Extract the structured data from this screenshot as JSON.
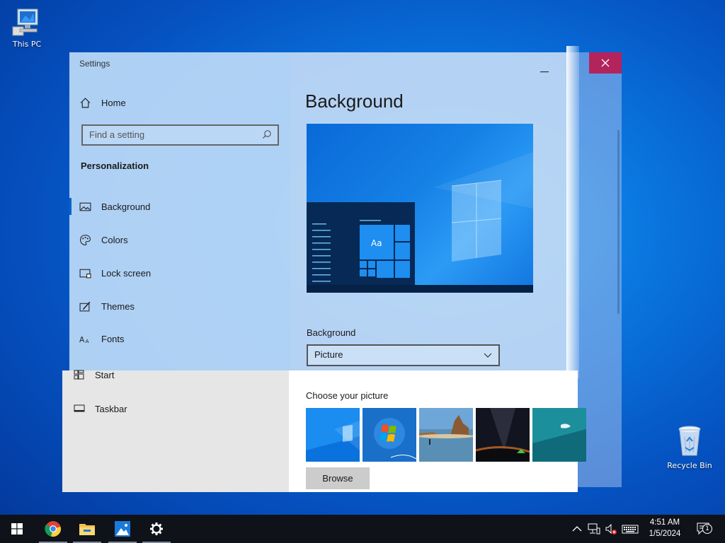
{
  "desktop": {
    "this_pc_label": "This PC",
    "recycle_bin_label": "Recycle Bin"
  },
  "window": {
    "title": "Settings",
    "home_label": "Home",
    "search_placeholder": "Find a setting",
    "section_label": "Personalization",
    "nav": [
      {
        "label": "Background",
        "icon": "picture-icon"
      },
      {
        "label": "Colors",
        "icon": "palette-icon"
      },
      {
        "label": "Lock screen",
        "icon": "lock-screen-icon"
      },
      {
        "label": "Themes",
        "icon": "themes-icon"
      },
      {
        "label": "Fonts",
        "icon": "fonts-icon"
      },
      {
        "label": "Start",
        "icon": "start-icon"
      },
      {
        "label": "Taskbar",
        "icon": "taskbar-icon"
      }
    ],
    "page_title": "Background",
    "preview_sample_text": "Aa",
    "background_label": "Background",
    "background_value": "Picture",
    "choose_picture_label": "Choose your picture",
    "browse_label": "Browse",
    "close_color": "#b3245d",
    "accent_color": "#0a63c9"
  },
  "taskbar": {
    "apps": [
      "start-icon",
      "chrome-icon",
      "file-explorer-icon",
      "photos-icon",
      "settings-icon"
    ],
    "time": "4:51 AM",
    "date": "1/5/2024",
    "notification_count": "1"
  }
}
